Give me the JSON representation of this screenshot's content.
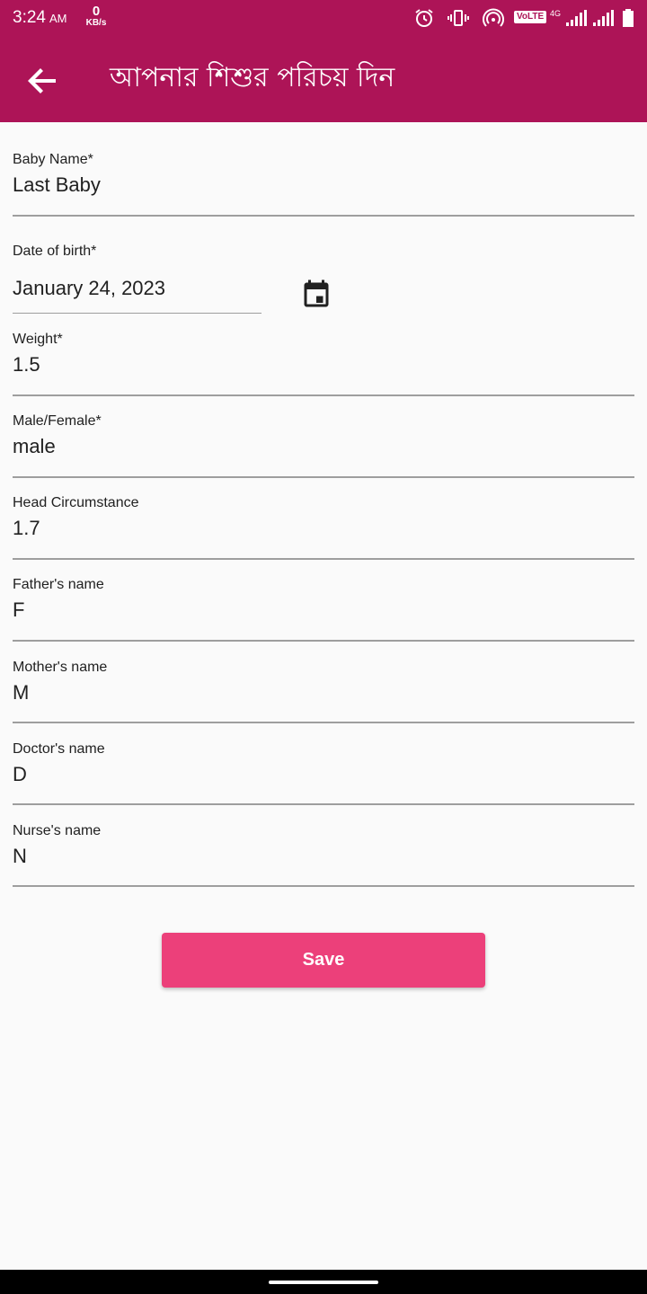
{
  "status_bar": {
    "time": "3:24",
    "ampm": "AM",
    "net_speed": "0",
    "net_unit": "KB/s",
    "volte": "VoLTE",
    "network": "4G",
    "icons": [
      "alarm-icon",
      "vibrate-icon",
      "hotspot-icon",
      "signal-icon",
      "signal-icon",
      "battery-icon"
    ]
  },
  "appbar": {
    "title": "আপনার শিশুর পরিচয় দিন",
    "back_icon": "arrow-back-icon"
  },
  "form": {
    "baby_name": {
      "label": "Baby Name*",
      "value": "Last Baby"
    },
    "dob": {
      "label": "Date of birth*",
      "value": "January 24, 2023",
      "icon": "calendar-icon"
    },
    "weight": {
      "label": "Weight*",
      "value": "1.5"
    },
    "gender": {
      "label": "Male/Female*",
      "value": "male"
    },
    "head": {
      "label": "Head Circumstance",
      "value": "1.7"
    },
    "father": {
      "label": "Father's name",
      "value": "F"
    },
    "mother": {
      "label": "Mother's name",
      "value": "M"
    },
    "doctor": {
      "label": "Doctor's name",
      "value": "D"
    },
    "nurse": {
      "label": "Nurse's name",
      "value": "N"
    }
  },
  "actions": {
    "save_label": "Save"
  },
  "colors": {
    "appbar": "#ad1457",
    "button": "#ec407a",
    "background": "#fafafa"
  }
}
